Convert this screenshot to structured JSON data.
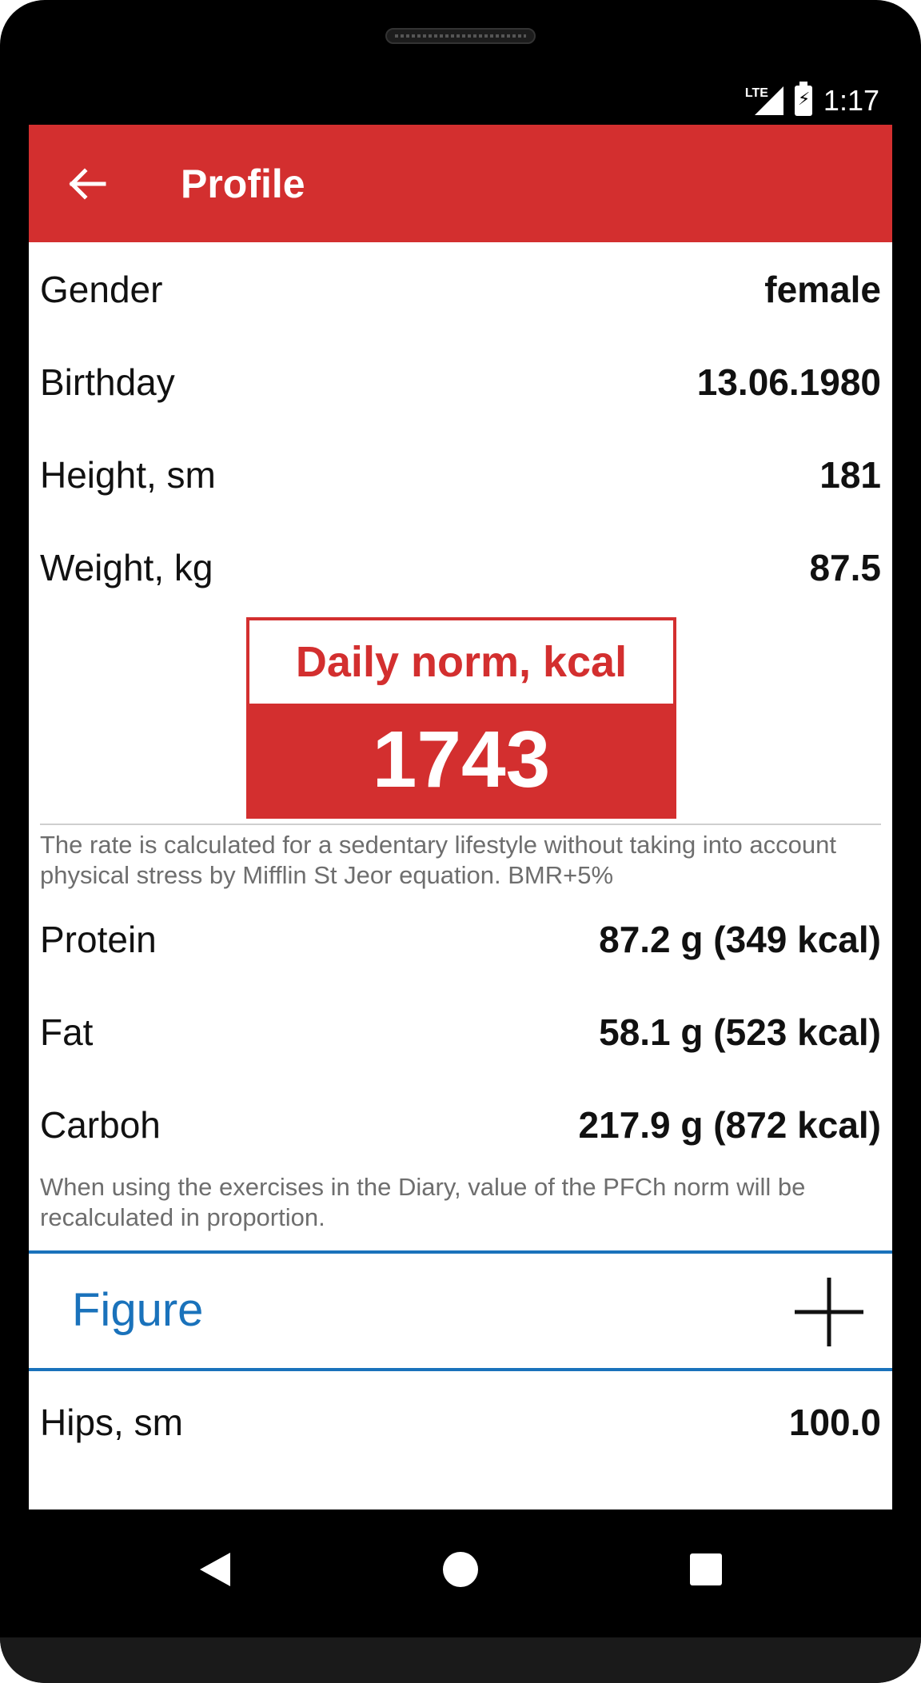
{
  "status_bar": {
    "network": "LTE",
    "time": "1:17"
  },
  "app_bar": {
    "title": "Profile",
    "back_icon": "arrow-left-icon"
  },
  "profile": {
    "gender": {
      "label": "Gender",
      "value": "female"
    },
    "birthday": {
      "label": "Birthday",
      "value": "13.06.1980"
    },
    "height": {
      "label": "Height, sm",
      "value": "181"
    },
    "weight": {
      "label": "Weight, kg",
      "value": "87.5"
    }
  },
  "daily_norm": {
    "title": "Daily norm, kcal",
    "value": "1743",
    "note": "The rate is calculated for a sedentary lifestyle without taking into account physical stress by Mifflin St Jeor equation. BMR+5%"
  },
  "macros": {
    "protein": {
      "label": "Protein",
      "value": "87.2 g (349 kcal)"
    },
    "fat": {
      "label": "Fat",
      "value": "58.1 g (523 kcal)"
    },
    "carboh": {
      "label": "Carboh",
      "value": "217.9 g (872 kcal)"
    },
    "note": "When using the exercises in the Diary, value of the PFCh norm will be recalculated in proportion."
  },
  "figure": {
    "title": "Figure",
    "add_icon": "plus-icon",
    "hips": {
      "label": "Hips, sm",
      "value": "100.0"
    }
  },
  "nav_bar": {
    "back_icon": "nav-back-icon",
    "home_icon": "nav-home-icon",
    "recents_icon": "nav-recents-icon"
  },
  "colors": {
    "accent_red": "#d32f2f",
    "accent_blue": "#1a72bb"
  }
}
